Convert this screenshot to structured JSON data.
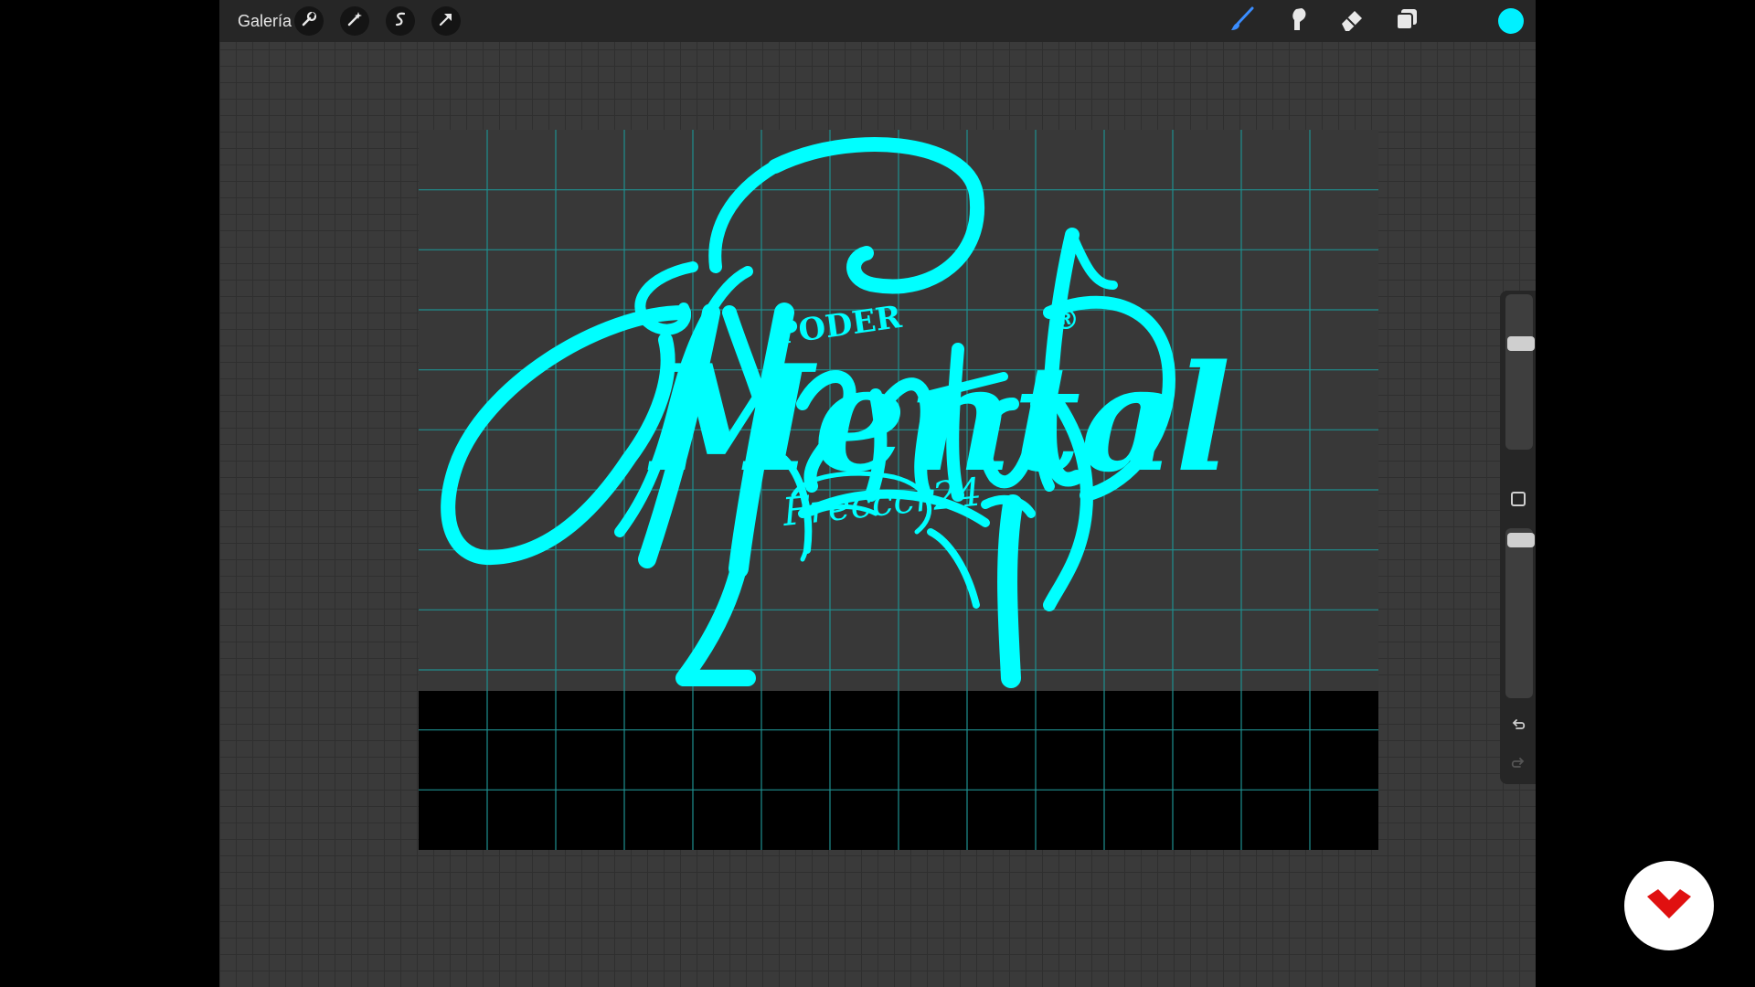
{
  "toolbar": {
    "gallery_label": "Galería",
    "actions_icon": "wrench-icon",
    "adjustments_icon": "magic-wand-icon",
    "selection_icon": "selection-s-icon",
    "transform_icon": "transform-arrow-icon",
    "brush_icon": "brush-icon",
    "smudge_icon": "smudge-finger-icon",
    "eraser_icon": "eraser-icon",
    "layers_icon": "layers-icon",
    "active_color": "#00f0ff"
  },
  "canvas": {
    "artwork_text": {
      "small_word": "PODER",
      "main_word": "Mental",
      "registered_mark": "®",
      "signature": "Frecccr24"
    },
    "artwork_color": "#00ffff",
    "grid_color": "#1f8f8f"
  },
  "sidebar": {
    "brush_size_level": 0.7,
    "opacity_level": 0.97,
    "undo_icon": "undo-icon",
    "redo_icon": "redo-icon",
    "modify_icon": "square-modify-icon"
  },
  "brand": {
    "logo_icon": "domestika-logo-icon",
    "logo_color": "#e01010"
  }
}
